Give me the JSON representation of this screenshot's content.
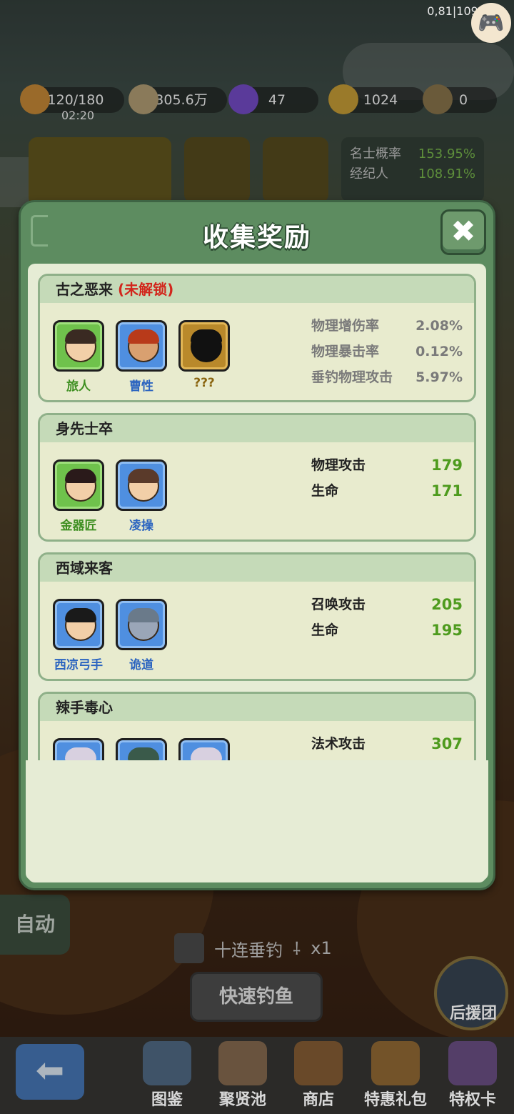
{
  "hud": {
    "fps": "0,81|1095",
    "stamina": "120/180",
    "stamina_timer": "02:20",
    "coins": "305.6万",
    "gems": "47",
    "tickets": "1024",
    "rods": "0"
  },
  "background": {
    "stats": [
      {
        "label": "名士概率",
        "value": "153.95%"
      },
      {
        "label": "经纪人",
        "value": "108.91%"
      }
    ],
    "auto_label": "自动",
    "ten_cast_label": "十连垂钓",
    "ten_cast_count": "x1",
    "fast_fish_label": "快速钓鱼",
    "support_label": "后援团"
  },
  "nav": {
    "items": [
      {
        "label": "图鉴"
      },
      {
        "label": "聚贤池"
      },
      {
        "label": "商店"
      },
      {
        "label": "特惠礼包"
      },
      {
        "label": "特权卡"
      }
    ]
  },
  "modal": {
    "title": "收集奖励",
    "close_glyph": "✖",
    "sets": [
      {
        "name": "古之恶来",
        "locked_label": "(未解锁)",
        "heroes": [
          {
            "name": "旅人",
            "rarity": "green"
          },
          {
            "name": "曹性",
            "rarity": "blue"
          },
          {
            "name": "???",
            "rarity": "gold"
          }
        ],
        "stats": [
          {
            "label": "物理增伤率",
            "value": "2.08%"
          },
          {
            "label": "物理暴击率",
            "value": "0.12%"
          },
          {
            "label": "垂钓物理攻击",
            "value": "5.97%"
          }
        ]
      },
      {
        "name": "身先士卒",
        "heroes": [
          {
            "name": "金器匠",
            "rarity": "green"
          },
          {
            "name": "凌操",
            "rarity": "blue"
          }
        ],
        "stats": [
          {
            "label": "物理攻击",
            "value": "179"
          },
          {
            "label": "生命",
            "value": "171"
          }
        ]
      },
      {
        "name": "西域来客",
        "heroes": [
          {
            "name": "西凉弓手",
            "rarity": "blue"
          },
          {
            "name": "诡道",
            "rarity": "blue"
          }
        ],
        "stats": [
          {
            "label": "召唤攻击",
            "value": "205"
          },
          {
            "label": "生命",
            "value": "195"
          }
        ]
      },
      {
        "name": "辣手毒心",
        "heroes": [
          {
            "name": "",
            "rarity": "blue"
          },
          {
            "name": "",
            "rarity": "blue"
          },
          {
            "name": "",
            "rarity": "blue"
          }
        ],
        "stats": [
          {
            "label": "法术攻击",
            "value": "307"
          }
        ]
      }
    ]
  }
}
